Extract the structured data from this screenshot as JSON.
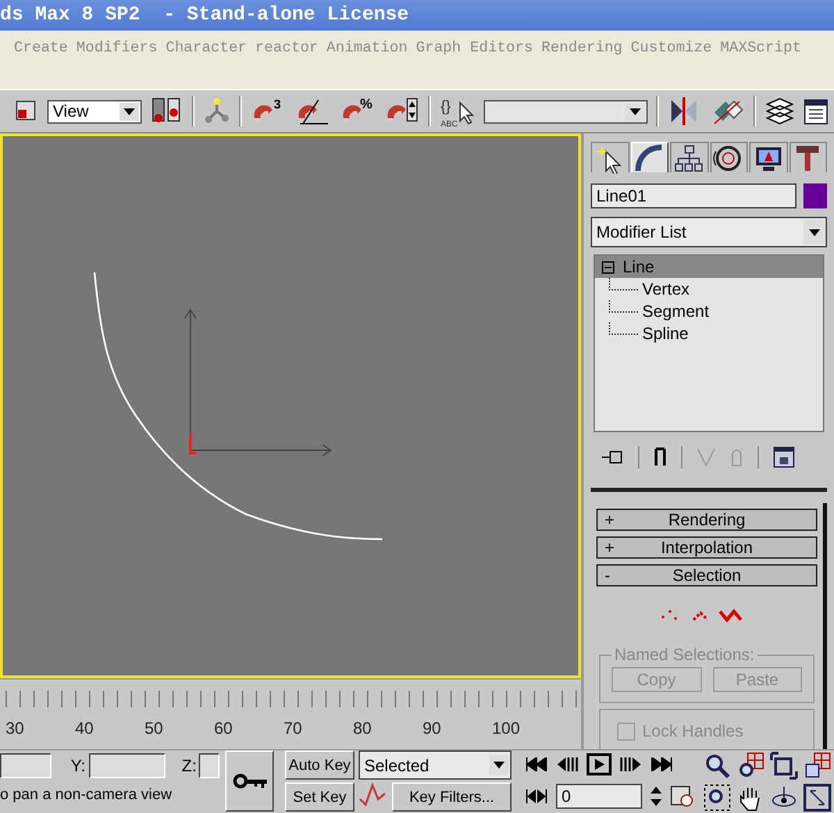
{
  "window": {
    "title": "ds Max 8 SP2  - Stand-alone License"
  },
  "menu": [
    "Create",
    "Modifiers",
    "Character",
    "reactor",
    "Animation",
    "Graph Editors",
    "Rendering",
    "Customize",
    "MAXScript"
  ],
  "toolbar": {
    "coordinate_system": "View",
    "icon_texts": [
      "3",
      "%",
      "{}",
      "ABC"
    ]
  },
  "command_panel": {
    "tabs": [
      {
        "selected": false
      },
      {
        "selected": true
      },
      {
        "selected": false
      },
      {
        "selected": false
      },
      {
        "selected": false
      },
      {
        "selected": false
      }
    ],
    "object_name": "Line01",
    "modifier_list": "Modifier List",
    "stack": [
      {
        "label": "Line",
        "selected": true,
        "expanded": true,
        "children": [
          {
            "label": "Vertex"
          },
          {
            "label": "Segment"
          },
          {
            "label": "Spline"
          }
        ]
      }
    ],
    "rollouts": [
      {
        "sign": "+",
        "title": "Rendering"
      },
      {
        "sign": "+",
        "title": "Interpolation"
      },
      {
        "sign": "-",
        "title": "Selection"
      }
    ],
    "named_selections": {
      "title": "Named Selections:",
      "buttons": [
        {
          "label": "Copy",
          "disabled": true
        },
        {
          "label": "Paste",
          "disabled": true
        }
      ]
    },
    "lock_handles": {
      "label": "Lock Handles",
      "checked": false,
      "disabled": true
    }
  },
  "timeline": {
    "ticks": [
      "30",
      "40",
      "50",
      "60",
      "70",
      "80",
      "90",
      "100"
    ]
  },
  "coordinates": {
    "y_label": "Y:",
    "z_label": "Z:"
  },
  "status": "o pan a non-camera view",
  "animation": {
    "auto_key": "Auto Key",
    "set_key": "Set Key",
    "key_mode": "Selected",
    "key_filters": "Key Filters...",
    "frame": "0"
  }
}
